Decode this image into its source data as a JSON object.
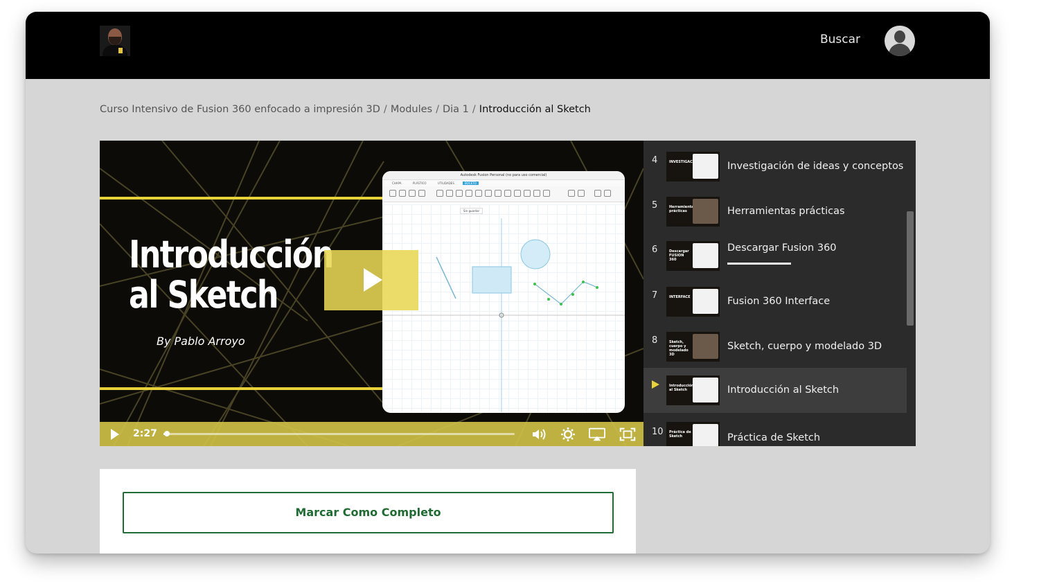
{
  "header": {
    "search_label": "Buscar",
    "logo_icon": "instructor-portrait-logo",
    "avatar_icon": "user-avatar-icon"
  },
  "breadcrumb": {
    "course": "Curso Intensivo de Fusion 360 enfocado a impresión 3D",
    "separator": "/",
    "section": "Modules",
    "day": "Dia 1",
    "current": "Introducción al Sketch"
  },
  "video": {
    "title_line1": "Introducción",
    "title_line2": "al Sketch",
    "byline": "By Pablo Arroyo",
    "screen_title": "Autodesk Fusion Personal (no para uso comercial)",
    "screen_tabs": [
      "CHAPA",
      "PLÁSTICO",
      "UTILIDADES",
      "BOCETO"
    ],
    "screen_warning": "Sin guardar",
    "current_time": "2:27",
    "progress_fraction": 0.01,
    "accent_color": "#e8d23a",
    "controls": {
      "play_icon": "play-icon",
      "volume_icon": "volume-icon",
      "settings_icon": "gear-icon",
      "airplay_icon": "airplay-icon",
      "fullscreen_icon": "fullscreen-icon"
    }
  },
  "playlist": {
    "items": [
      {
        "number": "4",
        "title": "Investigación de ideas y conceptos",
        "thumb_text": "INVESTIGACIÓN"
      },
      {
        "number": "5",
        "title": "Herramientas prácticas",
        "thumb_text": "Herramientas prácticas"
      },
      {
        "number": "6",
        "title": "Descargar Fusion 360",
        "thumb_text": "Descargar FUSION 360",
        "progress_fraction": 0.4
      },
      {
        "number": "7",
        "title": "Fusion 360 Interface",
        "thumb_text": "INTERFACE"
      },
      {
        "number": "8",
        "title": "Sketch, cuerpo y modelado 3D",
        "thumb_text": "Sketch, cuerpo y modelado 3D"
      },
      {
        "number": "",
        "title": "Introducción al Sketch",
        "thumb_text": "Introducción al Sketch",
        "active": true
      },
      {
        "number": "10",
        "title": "Práctica de Sketch",
        "thumb_text": "Práctica de Sketch"
      }
    ]
  },
  "actions": {
    "complete_label": "Marcar Como Completo",
    "complete_color": "#1f6b33"
  }
}
